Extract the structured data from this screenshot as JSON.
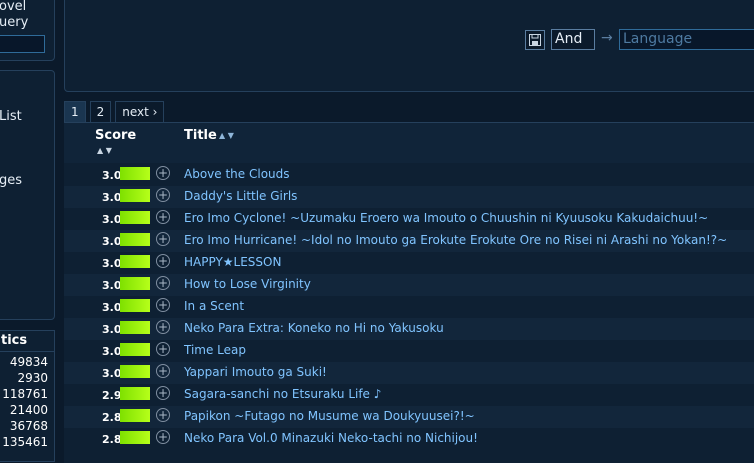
{
  "sidebar": {
    "top_lines": [
      "ovel",
      "uery"
    ],
    "menu_items": [
      "List",
      "ges"
    ],
    "stats_header": "tics",
    "stats": [
      "49834",
      "2930",
      "118761",
      "21400",
      "36768",
      "135461"
    ]
  },
  "filter": {
    "and_label": "And",
    "arrow": "→",
    "language_placeholder": "Language"
  },
  "pager": {
    "pages": [
      "1",
      "2"
    ],
    "next": "next ›"
  },
  "table": {
    "score_header": "Score",
    "title_header": "Title",
    "sort_glyph": "▲ ▼",
    "rows": [
      {
        "score": "3.0",
        "title": "Above the Clouds"
      },
      {
        "score": "3.0",
        "title": "Daddy's Little Girls"
      },
      {
        "score": "3.0",
        "title": "Ero Imo Cyclone! ~Uzumaku Eroero wa Imouto o Chuushin ni Kyuusoku Kakudaichuu!~"
      },
      {
        "score": "3.0",
        "title": "Ero Imo Hurricane! ~Idol no Imouto ga Erokute Erokute Ore no Risei ni Arashi no Yokan!?~"
      },
      {
        "score": "3.0",
        "title": "HAPPY★LESSON"
      },
      {
        "score": "3.0",
        "title": "How to Lose Virginity"
      },
      {
        "score": "3.0",
        "title": "In a Scent"
      },
      {
        "score": "3.0",
        "title": "Neko Para Extra: Koneko no Hi no Yakusoku"
      },
      {
        "score": "3.0",
        "title": "Time Leap"
      },
      {
        "score": "3.0",
        "title": "Yappari Imouto ga Suki!"
      },
      {
        "score": "2.9",
        "title": "Sagara-sanchi no Etsuraku Life ♪"
      },
      {
        "score": "2.8",
        "title": "Papikon ~Futago no Musume wa Doukyuusei?!~"
      },
      {
        "score": "2.8",
        "title": "Neko Para Vol.0 Minazuki Neko-tachi no Nichijou!"
      }
    ]
  }
}
